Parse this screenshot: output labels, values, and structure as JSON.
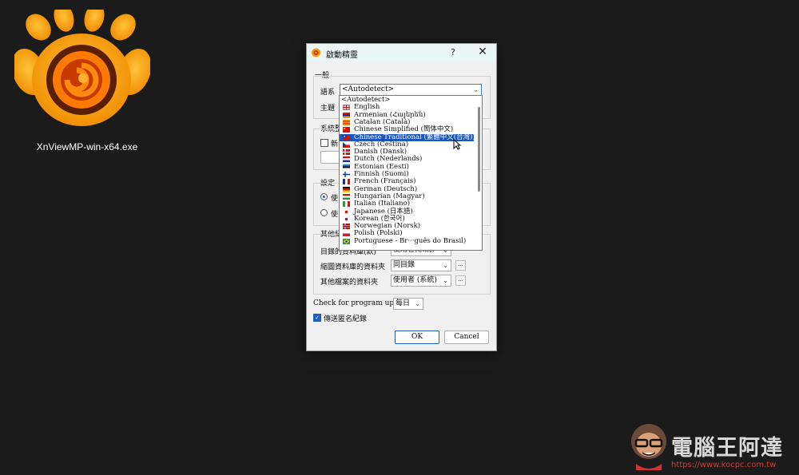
{
  "desktop": {
    "icon_name": "xnview-logo-icon",
    "file_label": "XnViewMP-win-x64.exe"
  },
  "dialog": {
    "title": "啟動精靈",
    "help": "?",
    "close": "✕",
    "general_group": "一般",
    "language_label": "語系",
    "language_value": "<Autodetect>",
    "theme_label": "主題",
    "system_group": "系統整",
    "new_label": "新",
    "settings_group": "設定",
    "radio1_label": "使",
    "radio2_label": "使",
    "other_group": "其他紀",
    "dir_label": "目錄的資料庫(默)",
    "dir_value": "使用者(系統)",
    "thumb_label": "縮圖資料庫的資料夾",
    "thumb_value": "同目錄",
    "other_files_label": "其他檔案的資料夾",
    "other_files_value": "使用者 (系統)",
    "updates_label": "Check for program updates",
    "updates_value": "每日",
    "anon_label": "傳送匿名紀錄",
    "anon_checked": true,
    "ok": "OK",
    "cancel": "Cancel",
    "ellipsis": "..."
  },
  "languages": [
    {
      "label": "<Autodetect>",
      "flag": "none"
    },
    {
      "label": "English",
      "flag": "uk"
    },
    {
      "label": "Armenian (Հայերեն)",
      "flag": "am"
    },
    {
      "label": "Catalan (Català)",
      "flag": "cat"
    },
    {
      "label": "Chinese Simplified (簡体中文)",
      "flag": "cn"
    },
    {
      "label": "Chinese Traditional (繁體中文(台灣))",
      "flag": "tw",
      "selected": true
    },
    {
      "label": "Czech (Čeština)",
      "flag": "cz"
    },
    {
      "label": "Danish (Dansk)",
      "flag": "dk"
    },
    {
      "label": "Dutch (Nederlands)",
      "flag": "nl"
    },
    {
      "label": "Estonian (Eesti)",
      "flag": "ee"
    },
    {
      "label": "Finnish (Suomi)",
      "flag": "fi"
    },
    {
      "label": "French (Français)",
      "flag": "fr"
    },
    {
      "label": "German (Deutsch)",
      "flag": "de"
    },
    {
      "label": "Hungarian (Magyar)",
      "flag": "hu"
    },
    {
      "label": "Italian (Italiano)",
      "flag": "it"
    },
    {
      "label": "Japanese (日本語)",
      "flag": "jp"
    },
    {
      "label": "Korean (한국어)",
      "flag": "kr"
    },
    {
      "label": "Norwegian (Norsk)",
      "flag": "no"
    },
    {
      "label": "Polish (Polski)",
      "flag": "pl"
    },
    {
      "label": "Portuguese - Br···guês do Brasil)",
      "flag": "br"
    }
  ],
  "watermark": {
    "brand": "電腦王阿達",
    "url": "https://www.kocpc.com.tw"
  }
}
